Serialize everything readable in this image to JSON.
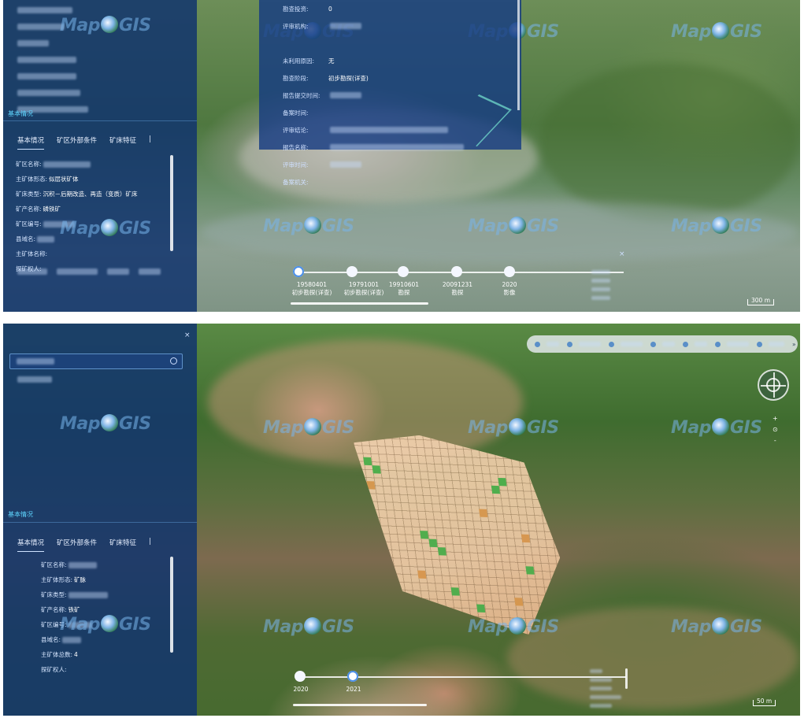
{
  "watermark": "MapGIS",
  "panel1": {
    "mine_list": [
      "",
      "",
      "",
      "",
      "",
      "",
      ""
    ],
    "section_title": "基本情况",
    "tabs": [
      "基本情况",
      "矿区外部条件",
      "矿床特征"
    ],
    "fields": [
      {
        "key": "矿区名称:",
        "value": ""
      },
      {
        "key": "主矿体形态:",
        "value": "似层状矿体"
      },
      {
        "key": "矿床类型:",
        "value": "沉积－后期改造、再造（变质）矿床"
      },
      {
        "key": "矿产名称:",
        "value": "磷铁矿"
      },
      {
        "key": "矿区编号:",
        "value": ""
      },
      {
        "key": "县域名:",
        "value": ""
      },
      {
        "key": "主矿体名称:",
        "value": ""
      },
      {
        "key": "探矿权人:",
        "value": ""
      }
    ],
    "links": [
      "",
      "",
      "",
      ""
    ],
    "popup": {
      "rows": [
        {
          "key": "勘查投资:",
          "value": "0"
        },
        {
          "key": "评审机构:",
          "value": ""
        },
        {
          "key": "",
          "value": ""
        },
        {
          "key": "未利用原因:",
          "value": "无"
        },
        {
          "key": "勘查阶段:",
          "value": "初步勘探(详查)"
        },
        {
          "key": "报告提交时间:",
          "value": ""
        },
        {
          "key": "备案时间:",
          "value": ""
        },
        {
          "key": "评审结论:",
          "value": ""
        },
        {
          "key": "报告名称:",
          "value": ""
        },
        {
          "key": "评审时间:",
          "value": ""
        },
        {
          "key": "备案机关:",
          "value": ""
        }
      ]
    },
    "timeline": [
      {
        "date": "19580401",
        "stage": "初步勘探(详查)"
      },
      {
        "date": "19791001",
        "stage": "初步勘探(详查)"
      },
      {
        "date": "19910601",
        "stage": "勘探"
      },
      {
        "date": "20091231",
        "stage": "勘探"
      },
      {
        "date": "2020",
        "stage": "影像"
      }
    ],
    "right_links": [
      "",
      "",
      "",
      ""
    ],
    "scale": "300 m"
  },
  "panel2": {
    "search_placeholder": "",
    "search_result": "",
    "section_title": "基本情况",
    "tabs": [
      "基本情况",
      "矿区外部条件",
      "矿床特征"
    ],
    "fields": [
      {
        "key": "矿区名称:",
        "value": ""
      },
      {
        "key": "主矿体形态:",
        "value": "矿脉"
      },
      {
        "key": "矿床类型:",
        "value": ""
      },
      {
        "key": "矿产名称:",
        "value": "铁矿"
      },
      {
        "key": "矿区编号:",
        "value": ""
      },
      {
        "key": "县域名:",
        "value": ""
      },
      {
        "key": "主矿体总数:",
        "value": "4"
      },
      {
        "key": "探矿权人:",
        "value": ""
      }
    ],
    "toolbar": [
      "",
      "",
      "",
      "",
      "",
      "",
      ""
    ],
    "timeline": [
      {
        "date": "2020",
        "stage": ""
      },
      {
        "date": "2021",
        "stage": ""
      }
    ],
    "right_links": [
      "",
      "",
      "",
      "",
      ""
    ],
    "scale": "50 m"
  }
}
